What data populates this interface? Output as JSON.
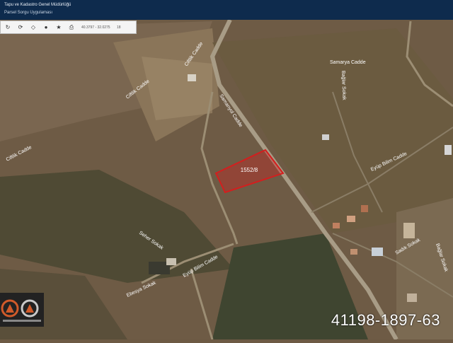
{
  "header": {
    "agency": "Tapu ve Kadastro Genel Müdürlüğü",
    "app": "Parsel Sorgu Uygulaması"
  },
  "toolbar": {
    "icons": [
      "refresh-icon",
      "rotate-icon",
      "diamond-icon",
      "circle-icon",
      "star-icon",
      "print-icon",
      "folder-icon"
    ],
    "coordinates": "40.3797 - 32.0275",
    "zoom": "18"
  },
  "map": {
    "streets": [
      "Ciftlik Cadde",
      "Ciftlik Cadde",
      "Ciftlik Cadde",
      "Samanyol Cadde",
      "Samarya Cadde",
      "Bağlar Sokak",
      "Eyüp Bilim Cadde",
      "Seher Sokak",
      "Eyüp Bilim Cadde",
      "Ebesya Sokak",
      "Sadık Sokak",
      "Bağlar Sokak"
    ],
    "parcel_label": "1552/8",
    "parcel_number": "41198-1897-63",
    "parcel_color": "#d41e1e"
  }
}
